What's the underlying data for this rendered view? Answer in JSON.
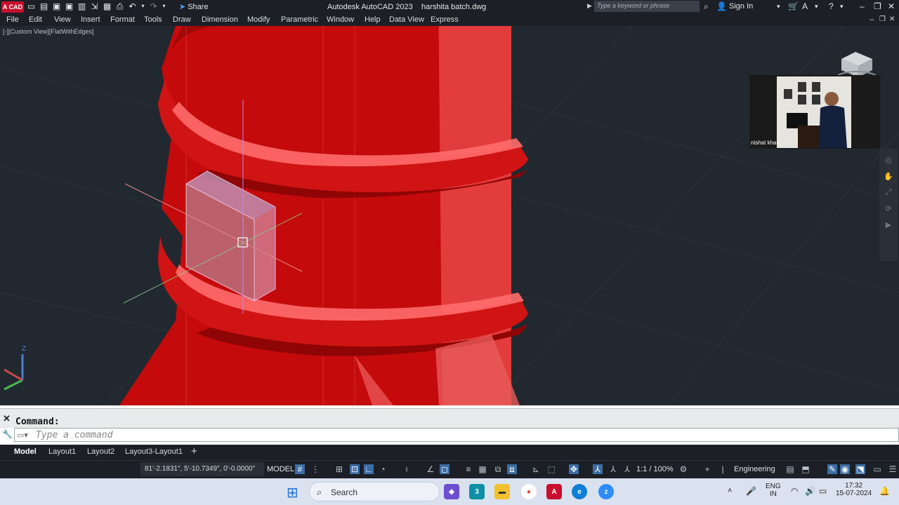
{
  "app": {
    "logo_text": "A CAD",
    "share_label": "Share",
    "title": "Autodesk AutoCAD 2023",
    "filename": "harshita batch.dwg",
    "search_placeholder": "Type a keyword or phrase",
    "sign_in": "Sign In"
  },
  "menu": {
    "items": [
      "File",
      "Edit",
      "View",
      "Insert",
      "Format",
      "Tools",
      "Draw",
      "Dimension",
      "Modify",
      "Parametric",
      "Window",
      "Help",
      "Data View",
      "Express"
    ]
  },
  "viewport": {
    "view_label": "[-][Custom View][FlatWithEdges]",
    "ucs_z": "Z"
  },
  "video_call": {
    "participant_name": "nishat khan"
  },
  "command": {
    "history": "Command:",
    "input_placeholder": "Type a command"
  },
  "layout_tabs": {
    "tabs": [
      "Model",
      "Layout1",
      "Layout2",
      "Layout3-Layout1"
    ],
    "add": "+"
  },
  "status": {
    "coordinates": "81'-2.1831\", 5'-10.7349\", 0'-0.0000\"",
    "model": "MODEL",
    "scale": "1:1 / 100%",
    "units": "Engineering"
  },
  "taskbar": {
    "search_label": "Search",
    "lang_top": "ENG",
    "lang_bottom": "IN",
    "time": "17:32",
    "date": "15-07-2024"
  }
}
